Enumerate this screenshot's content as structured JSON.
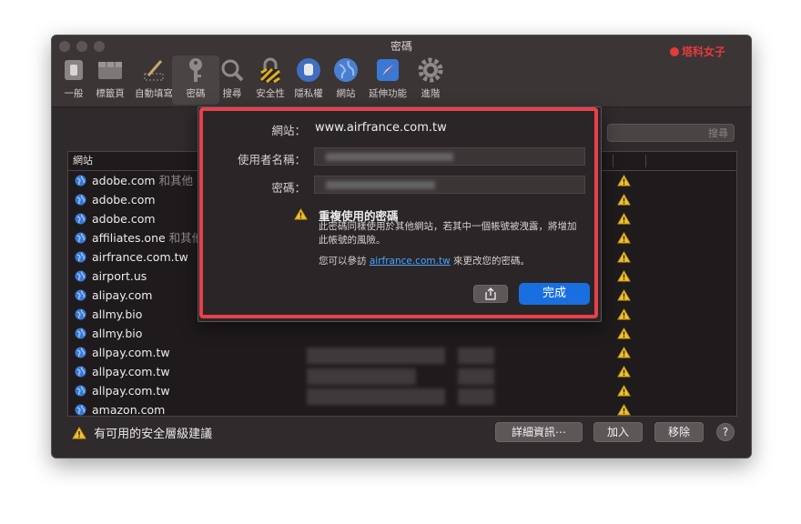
{
  "brand": {
    "text": "塔科女子"
  },
  "window": {
    "title": "密碼"
  },
  "toolbar": {
    "items": [
      {
        "label": "一般"
      },
      {
        "label": "標籤頁"
      },
      {
        "label": "自動填寫"
      },
      {
        "label": "密碼"
      },
      {
        "label": "搜尋"
      },
      {
        "label": "安全性"
      },
      {
        "label": "隱私權"
      },
      {
        "label": "網站"
      },
      {
        "label": "延伸功能"
      },
      {
        "label": "進階"
      }
    ]
  },
  "search": {
    "placeholder": "搜尋"
  },
  "list": {
    "header": {
      "site": "網站"
    },
    "rows": [
      {
        "site": "adobe.com",
        "more": " 和其他 1"
      },
      {
        "site": "adobe.com",
        "more": ""
      },
      {
        "site": "adobe.com",
        "more": ""
      },
      {
        "site": "affiliates.one",
        "more": " 和其他"
      },
      {
        "site": "airfrance.com.tw",
        "more": ""
      },
      {
        "site": "airport.us",
        "more": ""
      },
      {
        "site": "alipay.com",
        "more": ""
      },
      {
        "site": "allmy.bio",
        "more": ""
      },
      {
        "site": "allmy.bio",
        "more": ""
      },
      {
        "site": "allpay.com.tw",
        "more": ""
      },
      {
        "site": "allpay.com.tw",
        "more": ""
      },
      {
        "site": "allpay.com.tw",
        "more": ""
      },
      {
        "site": "amazon.com",
        "more": ""
      }
    ]
  },
  "footer": {
    "warning": "有可用的安全層級建議",
    "details_button": "詳細資訊⋯",
    "add_button": "加入",
    "remove_button": "移除",
    "help_button": "?"
  },
  "sheet": {
    "website_label": "網站：",
    "website_value": "www.airfrance.com.tw",
    "username_label": "使用者名稱：",
    "password_label": "密碼：",
    "reuse_title": "重複使用的密碼",
    "reuse_body": "此密碼同樣使用於其他網站，若其中一個帳號被洩露，將增加此帳號的風險。",
    "visit_prefix": "您可以參訪 ",
    "visit_link": "airfrance.com.tw",
    "visit_suffix": " 來更改您的密碼。",
    "done_button": "完成"
  },
  "colors": {
    "accent": "#1a6fe0",
    "warning": "#f2c12e",
    "highlight_frame": "#e8404a"
  }
}
